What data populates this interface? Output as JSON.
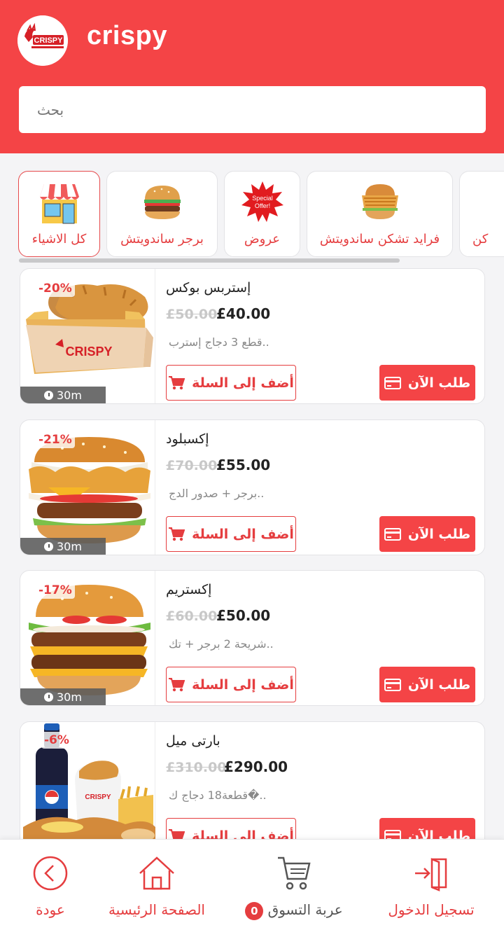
{
  "colors": {
    "primary": "#f44446",
    "accent_text": "#e53d3f"
  },
  "app": {
    "title": "crispy",
    "logo_text": "CRISPY"
  },
  "search": {
    "placeholder": "بحث"
  },
  "categories": [
    {
      "label": "كل الاشياء",
      "icon": "store-icon",
      "active": true
    },
    {
      "label": "برجر ساندويتش",
      "icon": "burger-icon"
    },
    {
      "label": "عروض",
      "icon": "special-offer-icon",
      "badge": "Special Offer!"
    },
    {
      "label": "فرايد تشكن ساندويتش",
      "icon": "chicken-sandwich-icon"
    },
    {
      "label": "كن",
      "icon": "category-icon"
    }
  ],
  "products": [
    {
      "name": "إستربس بوكس",
      "old_price": "£50.00",
      "price": "£40.00",
      "desc": "..قطع 3 دجاج إسترب",
      "discount": "-20%",
      "time": "30m",
      "image": "strips-box-image"
    },
    {
      "name": "إكسبلود",
      "old_price": "£70.00",
      "price": "£55.00",
      "desc": "..برجر + صدور الدج",
      "discount": "-21%",
      "time": "30m",
      "image": "chicken-burger-image"
    },
    {
      "name": "إكستريم",
      "old_price": "£60.00",
      "price": "£50.00",
      "desc": "..شريحة 2 برجر + تك",
      "discount": "-17%",
      "time": "30m",
      "image": "double-burger-image"
    },
    {
      "name": "بارتى ميل",
      "old_price": "£310.00",
      "price": "£290.00",
      "desc": "..�قطعة18 دجاج ك",
      "discount": "-6%",
      "time": "",
      "image": "party-meal-image"
    }
  ],
  "buttons": {
    "add_to_cart": "أضف إلى السلة",
    "order_now": "طلب الآن"
  },
  "nav": {
    "back": "عودة",
    "home": "الصفحة الرئيسية",
    "cart": "عربة التسوق",
    "cart_count": "0",
    "login": "تسجيل الدخول"
  }
}
